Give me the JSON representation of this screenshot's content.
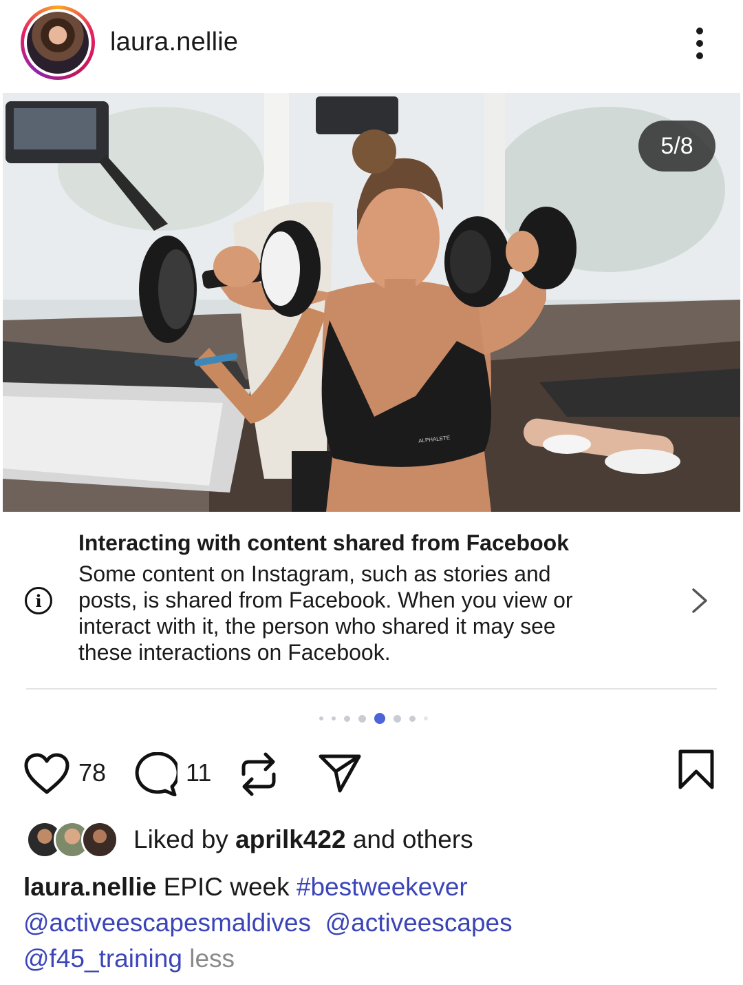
{
  "header": {
    "username": "laura.nellie"
  },
  "post": {
    "counter": "5/8",
    "photo_watermark": "ALPHALETE"
  },
  "notice": {
    "title": "Interacting with content shared from Facebook",
    "body_lines": [
      "Some content on Instagram, such as stories and",
      "posts, is shared from Facebook. When you view or",
      "interact with it, the person who shared it may see",
      "these interactions on Facebook."
    ],
    "info_glyph": "i"
  },
  "carousel": {
    "total": 8,
    "current_index": 5
  },
  "actions": {
    "likes": "78",
    "comments": "11"
  },
  "liked_by": {
    "prefix": "Liked by",
    "user": "aprilk422",
    "suffix": "and others"
  },
  "caption": {
    "user": "laura.nellie",
    "text": "EPIC week",
    "hashtag": "#bestweekever",
    "mentions": [
      "@activeescapesmaldives",
      "@activeescapes",
      "@f45_training"
    ],
    "less": "less"
  },
  "colors": {
    "accent": "#4c63d9",
    "link": "#3b45b8",
    "muted": "#8a8a8a",
    "counter_bg": "#282828"
  },
  "icons": [
    "more-vertical-icon",
    "info-icon",
    "chevron-right-icon",
    "heart-icon",
    "comment-icon",
    "repost-icon",
    "send-icon",
    "bookmark-icon"
  ]
}
